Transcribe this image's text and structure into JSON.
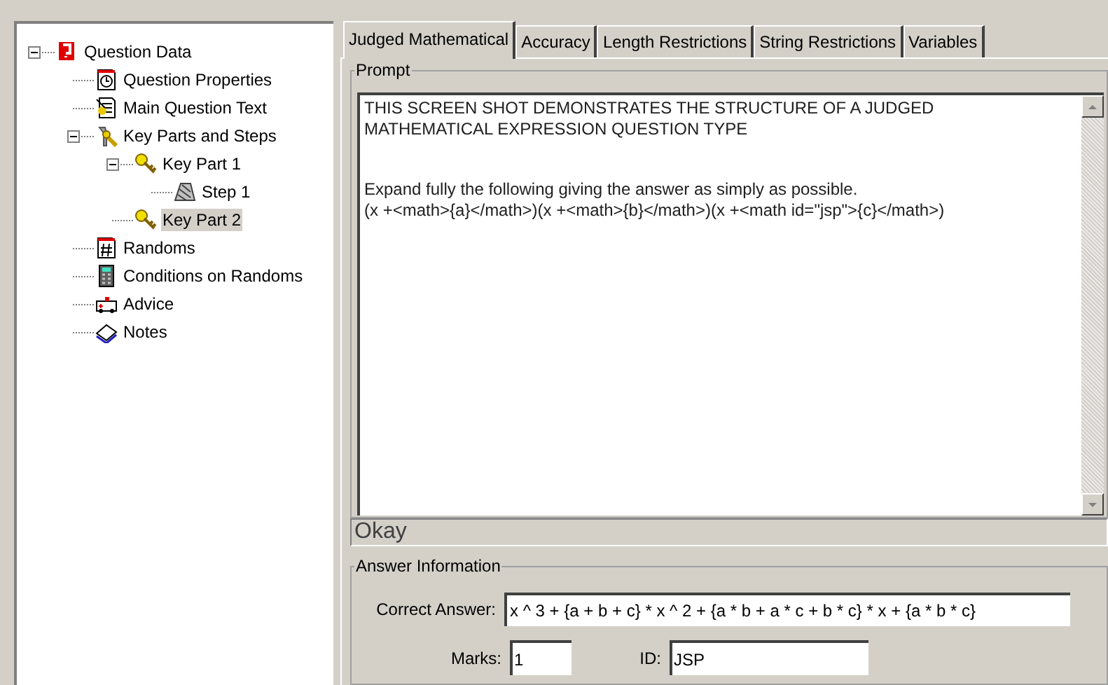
{
  "tree": [
    {
      "label": "Question Data",
      "kind": "root",
      "expanded": true,
      "selected": false,
      "children": [
        {
          "label": "Question Properties",
          "kind": "clock",
          "selected": false
        },
        {
          "label": "Main Question Text",
          "kind": "text",
          "selected": false
        },
        {
          "label": "Key Parts and Steps",
          "kind": "tools",
          "expanded": true,
          "selected": false,
          "children": [
            {
              "label": "Key Part 1",
              "kind": "key",
              "expanded": true,
              "selected": false,
              "children": [
                {
                  "label": "Step 1",
                  "kind": "step",
                  "selected": false
                }
              ]
            },
            {
              "label": "Key Part 2",
              "kind": "key",
              "selected": true
            }
          ]
        },
        {
          "label": "Randoms",
          "kind": "hash",
          "selected": false
        },
        {
          "label": "Conditions on Randoms",
          "kind": "calculator",
          "selected": false
        },
        {
          "label": "Advice",
          "kind": "ambulance",
          "selected": false
        },
        {
          "label": "Notes",
          "kind": "book",
          "selected": false
        }
      ]
    }
  ],
  "tabs": [
    {
      "label": "Judged Mathematical",
      "selected": true
    },
    {
      "label": "Accuracy",
      "selected": false
    },
    {
      "label": "Length Restrictions",
      "selected": false
    },
    {
      "label": "String Restrictions",
      "selected": false
    },
    {
      "label": "Variables",
      "selected": false
    }
  ],
  "prompt": {
    "title": "Prompt",
    "paragraphs": [
      "THIS SCREEN SHOT DEMONSTRATES THE STRUCTURE OF A JUDGED MATHEMATICAL EXPRESSION QUESTION TYPE",
      "Expand fully the following giving the answer as simply as possible.\n(x +<math>{a}</math>)(x +<math>{b}</math>)(x +<math id=\"jsp\">{c}</math>)"
    ]
  },
  "status": "Okay",
  "answer": {
    "title": "Answer Information",
    "correct_answer_label": "Correct Answer:",
    "correct_answer": "x ^ 3 + {a + b + c} * x ^ 2 + {a * b + a * c + b * c} * x + {a * b * c}",
    "marks_label": "Marks:",
    "marks": "1",
    "id_label": "ID:",
    "id": "JSP"
  }
}
